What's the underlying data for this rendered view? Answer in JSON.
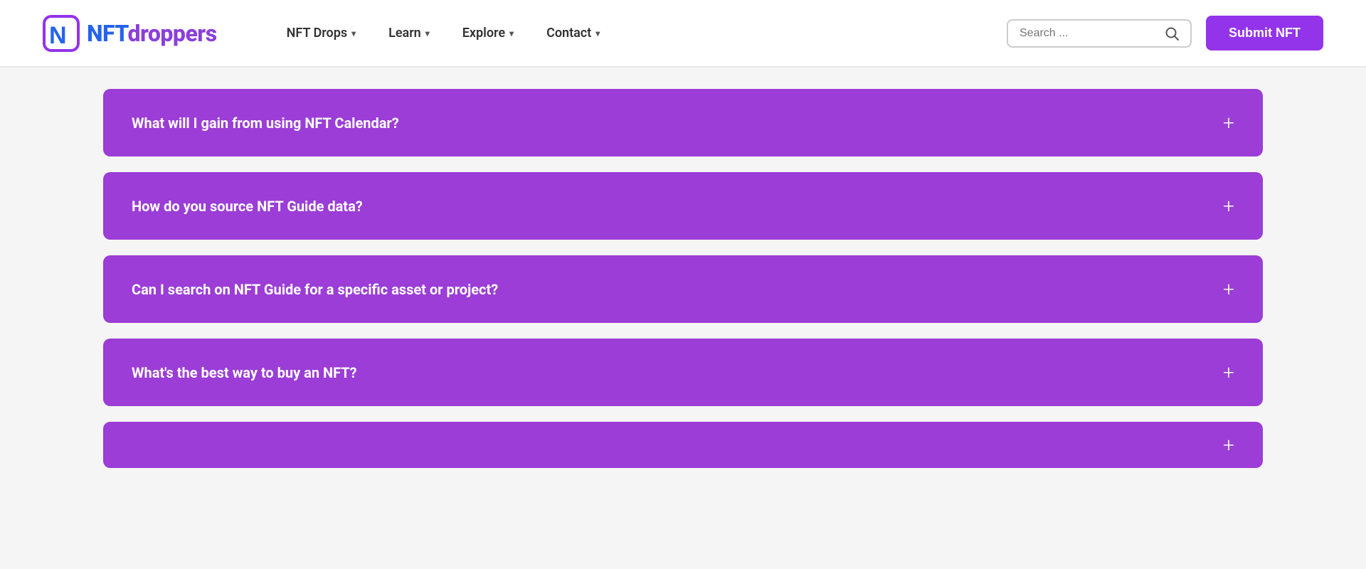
{
  "header": {
    "logo_text_nft": "NFT",
    "logo_text_droppers": "droppers",
    "nav": {
      "items": [
        {
          "label": "NFT Drops",
          "has_dropdown": true
        },
        {
          "label": "Learn",
          "has_dropdown": true
        },
        {
          "label": "Explore",
          "has_dropdown": true
        },
        {
          "label": "Contact",
          "has_dropdown": true
        }
      ]
    },
    "search_placeholder": "Search ...",
    "submit_button_label": "Submit NFT"
  },
  "faq": {
    "items": [
      {
        "question": "What will I gain from using NFT Calendar?"
      },
      {
        "question": "How do you source NFT Guide data?"
      },
      {
        "question": "Can I search on NFT Guide for a specific asset or project?"
      },
      {
        "question": "What's the best way to buy an NFT?"
      },
      {
        "question": ""
      }
    ]
  }
}
